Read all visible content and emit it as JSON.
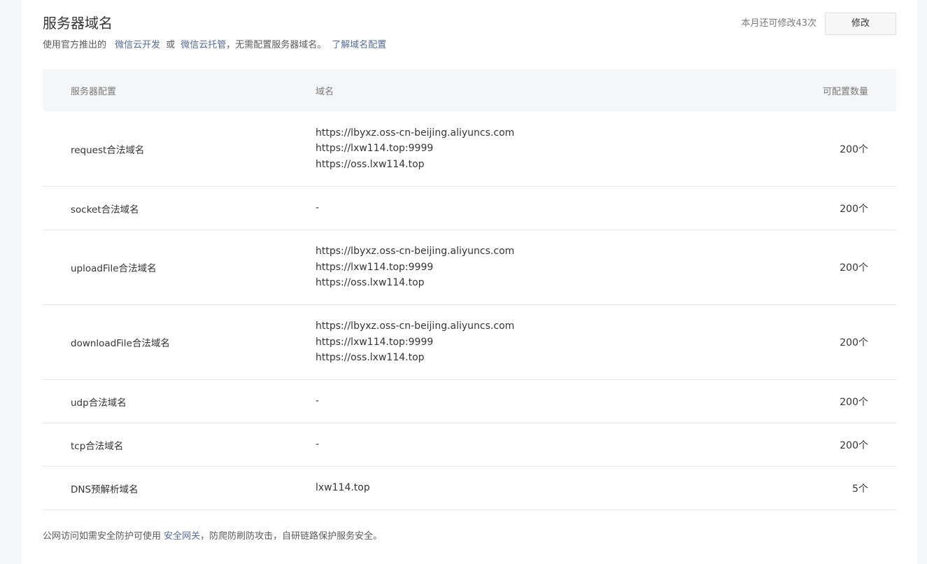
{
  "header": {
    "title": "服务器域名",
    "desc_prefix": "使用官方推出的",
    "link_cloud_dev": "微信云开发",
    "desc_or": "或",
    "link_cloud_host": "微信云托管",
    "desc_suffix": "，无需配置服务器域名。",
    "link_learn": "了解域名配置",
    "quota_text": "本月还可修改43次",
    "edit_label": "修改"
  },
  "table": {
    "columns": [
      "服务器配置",
      "域名",
      "可配置数量"
    ],
    "rows": [
      {
        "name": "request合法域名",
        "domains": [
          "https://lbyxz.oss-cn-beijing.aliyuncs.com",
          "https://lxw114.top:9999",
          "https://oss.lxw114.top"
        ],
        "count": "200个"
      },
      {
        "name": "socket合法域名",
        "domains": [
          "-"
        ],
        "count": "200个"
      },
      {
        "name": "uploadFile合法域名",
        "domains": [
          "https://lbyxz.oss-cn-beijing.aliyuncs.com",
          "https://lxw114.top:9999",
          "https://oss.lxw114.top"
        ],
        "count": "200个"
      },
      {
        "name": "downloadFile合法域名",
        "domains": [
          "https://lbyxz.oss-cn-beijing.aliyuncs.com",
          "https://lxw114.top:9999",
          "https://oss.lxw114.top"
        ],
        "count": "200个"
      },
      {
        "name": "udp合法域名",
        "domains": [
          "-"
        ],
        "count": "200个"
      },
      {
        "name": "tcp合法域名",
        "domains": [
          "-"
        ],
        "count": "200个"
      },
      {
        "name": "DNS预解析域名",
        "domains": [
          "lxw114.top"
        ],
        "count": "5个"
      }
    ]
  },
  "footer": {
    "prefix": "公网访问如需安全防护可使用",
    "link": "安全网关",
    "suffix": "，防爬防刷防攻击，自研链路保护服务安全。"
  },
  "colors": {
    "link": "#576b95",
    "header_bg": "#f5f6f8",
    "page_bg": "#f6f7f9"
  }
}
